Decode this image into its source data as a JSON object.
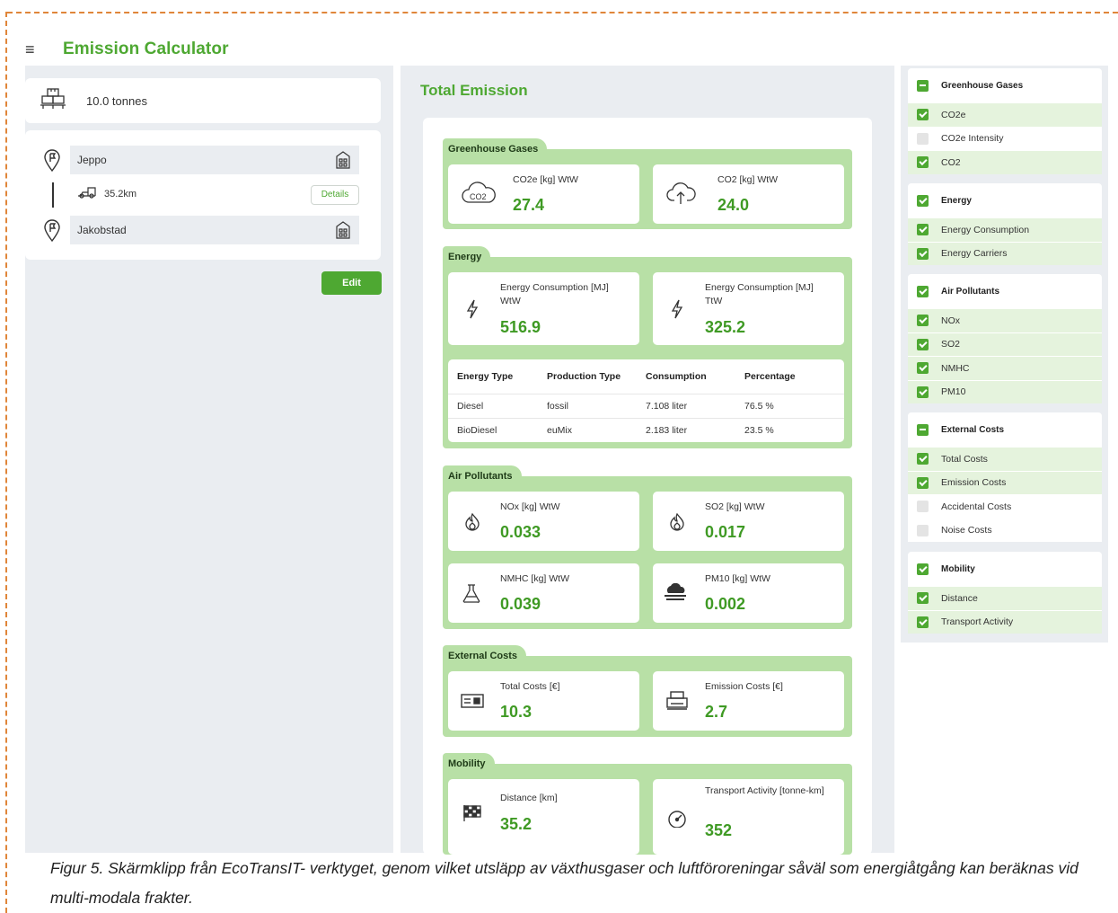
{
  "app": {
    "title": "Emission Calculator"
  },
  "cargo": {
    "weight": "10.0 tonnes"
  },
  "route": {
    "origin": "Jeppo",
    "destination": "Jakobstad",
    "segment_distance": "35.2km",
    "details_label": "Details"
  },
  "edit_label": "Edit",
  "total": {
    "title": "Total Emission",
    "greenhouse": {
      "title": "Greenhouse Gases",
      "metrics": [
        {
          "label": "CO2e [kg] WtW",
          "value": "27.4",
          "icon": "co2-cloud-icon"
        },
        {
          "label": "CO2 [kg] WtW",
          "value": "24.0",
          "icon": "cloud-upload-icon"
        }
      ]
    },
    "energy": {
      "title": "Energy",
      "metrics": [
        {
          "label": "Energy Consumption [MJ] WtW",
          "value": "516.9",
          "icon": "lightning-icon"
        },
        {
          "label": "Energy Consumption [MJ] TtW",
          "value": "325.2",
          "icon": "lightning-icon"
        }
      ],
      "table": {
        "headers": [
          "Energy Type",
          "Production Type",
          "Consumption",
          "Percentage"
        ],
        "rows": [
          [
            "Diesel",
            "fossil",
            "7.108 liter",
            "76.5 %"
          ],
          [
            "BioDiesel",
            "euMix",
            "2.183 liter",
            "23.5 %"
          ]
        ]
      }
    },
    "air": {
      "title": "Air Pollutants",
      "metrics": [
        {
          "label": "NOx [kg] WtW",
          "value": "0.033",
          "icon": "flame-icon"
        },
        {
          "label": "SO2 [kg] WtW",
          "value": "0.017",
          "icon": "flame-icon"
        },
        {
          "label": "NMHC [kg] WtW",
          "value": "0.039",
          "icon": "flask-icon"
        },
        {
          "label": "PM10 [kg] WtW",
          "value": "0.002",
          "icon": "smog-icon"
        }
      ]
    },
    "costs": {
      "title": "External Costs",
      "metrics": [
        {
          "label": "Total Costs [€]",
          "value": "10.3",
          "icon": "bill-icon"
        },
        {
          "label": "Emission Costs [€]",
          "value": "2.7",
          "icon": "printer-icon"
        }
      ]
    },
    "mobility": {
      "title": "Mobility",
      "metrics": [
        {
          "label": "Distance [km]",
          "value": "35.2",
          "icon": "checkered-flag-icon"
        },
        {
          "label": "Transport Activity [tonne-km]",
          "value": "352",
          "icon": "speedometer-icon"
        }
      ]
    }
  },
  "filters": {
    "greenhouse": {
      "title": "Greenhouse Gases",
      "options": [
        "CO2e",
        "CO2e Intensity",
        "CO2"
      ]
    },
    "energy": {
      "title": "Energy",
      "options": [
        "Energy Consumption",
        "Energy Carriers"
      ]
    },
    "air": {
      "title": "Air Pollutants",
      "options": [
        "NOx",
        "SO2",
        "NMHC",
        "PM10"
      ]
    },
    "costs": {
      "title": "External Costs",
      "options": [
        "Total Costs",
        "Emission Costs",
        "Accidental Costs",
        "Noise Costs"
      ]
    },
    "mobility": {
      "title": "Mobility",
      "options": [
        "Distance",
        "Transport Activity"
      ]
    }
  },
  "caption": "Figur 5. Skärmklipp från EcoTransIT- verktyget, genom vilket utsläpp av växthusgaser och luftföroreningar såväl som energiåtgång kan beräknas vid multi-modala frakter.",
  "colors": {
    "accent": "#4ea832",
    "section_bg": "#b8e0a6",
    "panel_bg": "#eaedf1",
    "border": "#e0863a"
  }
}
